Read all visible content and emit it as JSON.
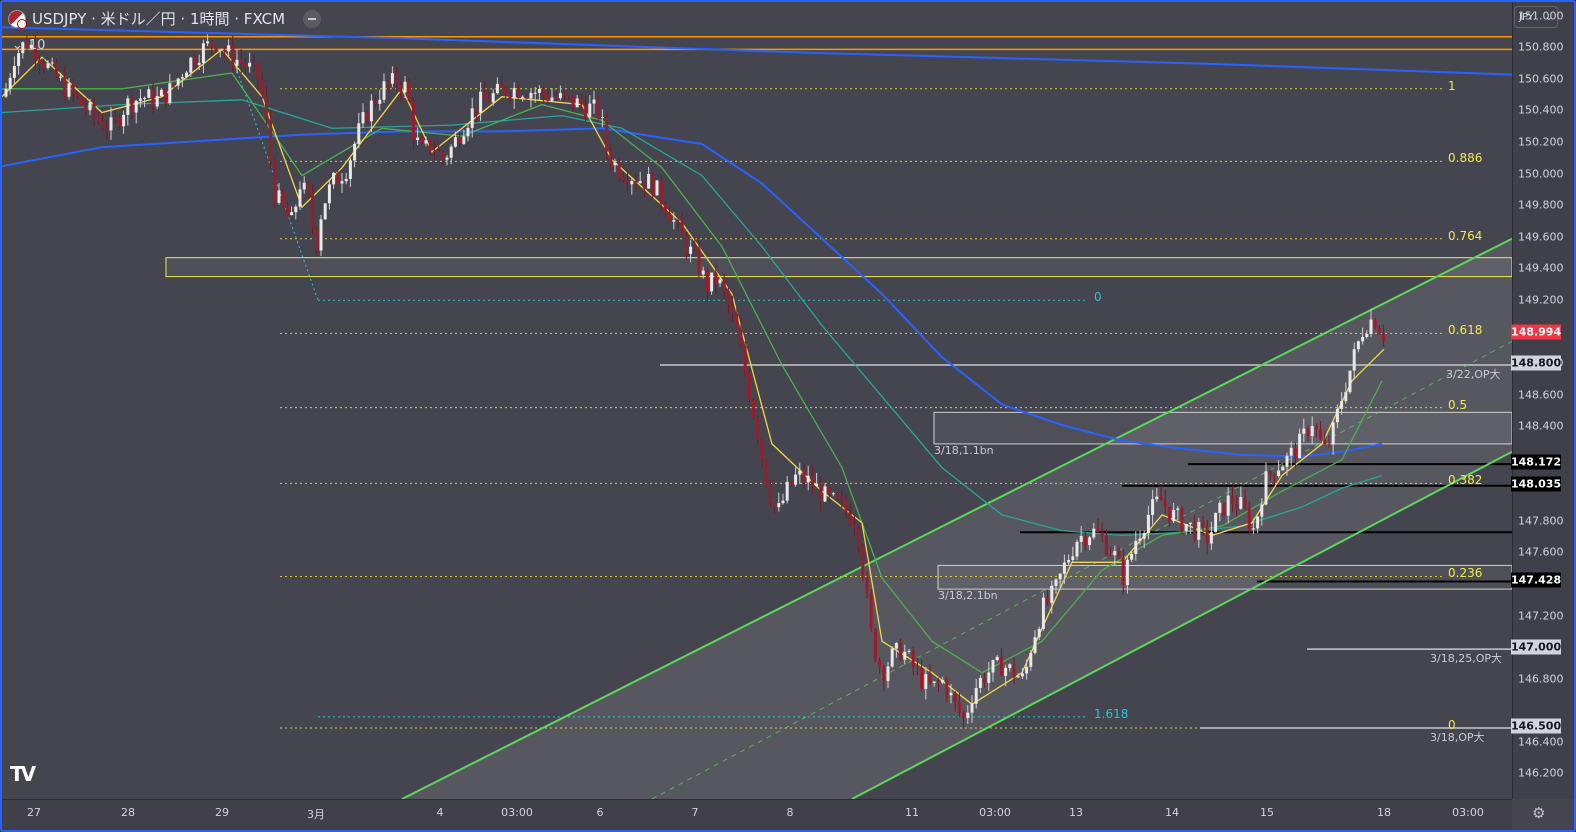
{
  "header": {
    "title": "USDJPY · 米ドル／円 · 1時間 · FXCM",
    "indicator_toggle": "10"
  },
  "currency_selector": "JPY",
  "colors": {
    "bull": "#e8e8e8",
    "bear": "#9b1c2b",
    "ema_fast": "#f5d547",
    "ema_mid": "#4caf50",
    "ema_slow": "#26a69a",
    "ma_long": "#2962ff",
    "channel": "#5bd85b",
    "fib": "#f2e94e",
    "current_price": "#f23645"
  },
  "chart_data": {
    "type": "candlestick",
    "title": "USDJPY · 米ドル／円 · 1時間 · FXCM",
    "ylim": [
      146.05,
      151.1
    ],
    "y_ticks": [
      "151.000",
      "150.800",
      "150.600",
      "150.400",
      "150.200",
      "150.000",
      "149.800",
      "149.600",
      "149.400",
      "149.200",
      "148.800",
      "148.600",
      "148.400",
      "147.800",
      "147.600",
      "147.200",
      "146.800",
      "146.400",
      "146.200"
    ],
    "x_ticks": [
      "27",
      "28",
      "29",
      "3月",
      "4",
      "03:00",
      "6",
      "7",
      "8",
      "11",
      "03:00",
      "13",
      "14",
      "15",
      "18",
      "03:00"
    ],
    "close_path": [
      [
        0,
        150.45
      ],
      [
        12,
        150.75
      ],
      [
        24,
        150.85
      ],
      [
        36,
        150.78
      ],
      [
        50,
        150.65
      ],
      [
        64,
        150.55
      ],
      [
        80,
        150.45
      ],
      [
        96,
        150.35
      ],
      [
        110,
        150.3
      ],
      [
        124,
        150.45
      ],
      [
        140,
        150.5
      ],
      [
        156,
        150.48
      ],
      [
        170,
        150.55
      ],
      [
        184,
        150.7
      ],
      [
        200,
        150.8
      ],
      [
        214,
        150.85
      ],
      [
        228,
        150.76
      ],
      [
        244,
        150.7
      ],
      [
        258,
        150.6
      ],
      [
        266,
        150.25
      ],
      [
        272,
        149.9
      ],
      [
        280,
        149.8
      ],
      [
        290,
        149.7
      ],
      [
        298,
        149.95
      ],
      [
        306,
        149.85
      ],
      [
        314,
        149.55
      ],
      [
        320,
        149.8
      ],
      [
        330,
        149.95
      ],
      [
        345,
        150.05
      ],
      [
        355,
        150.25
      ],
      [
        365,
        150.4
      ],
      [
        380,
        150.55
      ],
      [
        395,
        150.6
      ],
      [
        405,
        150.55
      ],
      [
        412,
        150.25
      ],
      [
        420,
        150.15
      ],
      [
        430,
        150.2
      ],
      [
        440,
        150.1
      ],
      [
        450,
        150.18
      ],
      [
        460,
        150.3
      ],
      [
        475,
        150.45
      ],
      [
        490,
        150.5
      ],
      [
        505,
        150.55
      ],
      [
        520,
        150.55
      ],
      [
        540,
        150.52
      ],
      [
        560,
        150.48
      ],
      [
        580,
        150.45
      ],
      [
        598,
        150.4
      ],
      [
        605,
        150.15
      ],
      [
        615,
        150.05
      ],
      [
        630,
        150.0
      ],
      [
        650,
        149.95
      ],
      [
        665,
        149.8
      ],
      [
        680,
        149.6
      ],
      [
        695,
        149.45
      ],
      [
        705,
        149.3
      ],
      [
        715,
        149.35
      ],
      [
        725,
        149.2
      ],
      [
        735,
        149.0
      ],
      [
        745,
        148.7
      ],
      [
        755,
        148.4
      ],
      [
        765,
        148.05
      ],
      [
        775,
        147.85
      ],
      [
        785,
        148.0
      ],
      [
        795,
        148.1
      ],
      [
        810,
        148.05
      ],
      [
        825,
        147.95
      ],
      [
        840,
        147.9
      ],
      [
        855,
        147.8
      ],
      [
        862,
        147.45
      ],
      [
        870,
        147.05
      ],
      [
        880,
        146.85
      ],
      [
        890,
        146.95
      ],
      [
        900,
        147.0
      ],
      [
        910,
        146.9
      ],
      [
        920,
        146.8
      ],
      [
        930,
        146.75
      ],
      [
        942,
        146.8
      ],
      [
        952,
        146.65
      ],
      [
        962,
        146.55
      ],
      [
        972,
        146.75
      ],
      [
        985,
        146.85
      ],
      [
        1000,
        146.9
      ],
      [
        1012,
        146.85
      ],
      [
        1022,
        146.8
      ],
      [
        1030,
        147.05
      ],
      [
        1040,
        147.25
      ],
      [
        1052,
        147.35
      ],
      [
        1064,
        147.55
      ],
      [
        1075,
        147.7
      ],
      [
        1090,
        147.75
      ],
      [
        1100,
        147.7
      ],
      [
        1112,
        147.6
      ],
      [
        1122,
        147.45
      ],
      [
        1134,
        147.7
      ],
      [
        1146,
        147.85
      ],
      [
        1158,
        147.95
      ],
      [
        1170,
        147.85
      ],
      [
        1182,
        147.8
      ],
      [
        1194,
        147.75
      ],
      [
        1206,
        147.7
      ],
      [
        1216,
        147.85
      ],
      [
        1228,
        147.95
      ],
      [
        1240,
        147.9
      ],
      [
        1252,
        147.75
      ],
      [
        1262,
        148.05
      ],
      [
        1272,
        148.15
      ],
      [
        1285,
        148.2
      ],
      [
        1298,
        148.3
      ],
      [
        1310,
        148.45
      ],
      [
        1322,
        148.25
      ],
      [
        1330,
        148.35
      ],
      [
        1340,
        148.6
      ],
      [
        1352,
        148.85
      ],
      [
        1362,
        149.05
      ],
      [
        1372,
        149.1
      ],
      [
        1382,
        148.99
      ]
    ],
    "series": [
      {
        "name": "",
        "color": "#2962ff",
        "points": [
          [
            0,
            150.06
          ],
          [
            100,
            150.18
          ],
          [
            200,
            150.22
          ],
          [
            300,
            150.26
          ],
          [
            400,
            150.28
          ],
          [
            500,
            150.28
          ],
          [
            600,
            150.3
          ],
          [
            700,
            150.2
          ],
          [
            760,
            149.95
          ],
          [
            820,
            149.6
          ],
          [
            880,
            149.25
          ],
          [
            940,
            148.85
          ],
          [
            1000,
            148.55
          ],
          [
            1060,
            148.42
          ],
          [
            1120,
            148.32
          ],
          [
            1180,
            148.27
          ],
          [
            1240,
            148.23
          ],
          [
            1300,
            148.22
          ],
          [
            1340,
            148.25
          ],
          [
            1380,
            148.3
          ]
        ]
      },
      {
        "name": "",
        "color": "#2962ff",
        "points": [
          [
            0,
            150.94
          ],
          [
            400,
            150.87
          ],
          [
            800,
            150.78
          ],
          [
            1200,
            150.71
          ],
          [
            1510,
            150.64
          ]
        ]
      },
      {
        "name": "",
        "color": "#26a69a",
        "points": [
          [
            0,
            150.4
          ],
          [
            120,
            150.45
          ],
          [
            240,
            150.48
          ],
          [
            330,
            150.3
          ],
          [
            450,
            150.32
          ],
          [
            560,
            150.38
          ],
          [
            620,
            150.3
          ],
          [
            700,
            150.0
          ],
          [
            760,
            149.55
          ],
          [
            820,
            149.05
          ],
          [
            880,
            148.6
          ],
          [
            940,
            148.15
          ],
          [
            1000,
            147.85
          ],
          [
            1060,
            147.75
          ],
          [
            1120,
            147.72
          ],
          [
            1180,
            147.74
          ],
          [
            1240,
            147.78
          ],
          [
            1300,
            147.9
          ],
          [
            1340,
            148.02
          ],
          [
            1380,
            148.1
          ]
        ]
      },
      {
        "name": "",
        "color": "#4caf50",
        "points": [
          [
            0,
            150.55
          ],
          [
            120,
            150.55
          ],
          [
            230,
            150.65
          ],
          [
            300,
            150.0
          ],
          [
            380,
            150.3
          ],
          [
            460,
            150.25
          ],
          [
            540,
            150.45
          ],
          [
            600,
            150.35
          ],
          [
            660,
            150.05
          ],
          [
            720,
            149.55
          ],
          [
            780,
            148.8
          ],
          [
            840,
            148.15
          ],
          [
            880,
            147.45
          ],
          [
            930,
            147.05
          ],
          [
            980,
            146.85
          ],
          [
            1040,
            147.05
          ],
          [
            1100,
            147.5
          ],
          [
            1160,
            147.72
          ],
          [
            1220,
            147.78
          ],
          [
            1280,
            148.0
          ],
          [
            1340,
            148.2
          ],
          [
            1380,
            148.7
          ]
        ]
      },
      {
        "name": "",
        "color": "#f5d547",
        "points": [
          [
            0,
            150.5
          ],
          [
            40,
            150.75
          ],
          [
            100,
            150.4
          ],
          [
            160,
            150.5
          ],
          [
            220,
            150.8
          ],
          [
            260,
            150.5
          ],
          [
            300,
            149.8
          ],
          [
            340,
            150.05
          ],
          [
            400,
            150.55
          ],
          [
            430,
            150.15
          ],
          [
            500,
            150.5
          ],
          [
            580,
            150.45
          ],
          [
            610,
            150.1
          ],
          [
            680,
            149.7
          ],
          [
            730,
            149.25
          ],
          [
            770,
            148.3
          ],
          [
            820,
            148.0
          ],
          [
            860,
            147.8
          ],
          [
            880,
            147.05
          ],
          [
            930,
            146.85
          ],
          [
            970,
            146.65
          ],
          [
            1020,
            146.85
          ],
          [
            1070,
            147.55
          ],
          [
            1120,
            147.55
          ],
          [
            1160,
            147.85
          ],
          [
            1210,
            147.72
          ],
          [
            1250,
            147.8
          ],
          [
            1280,
            148.1
          ],
          [
            1320,
            148.3
          ],
          [
            1350,
            148.7
          ],
          [
            1382,
            148.9
          ]
        ]
      }
    ],
    "channel": {
      "upper": [
        [
          400,
          146.05
        ],
        [
          1510,
          149.6
        ]
      ],
      "lower": [
        [
          850,
          146.05
        ],
        [
          1510,
          148.25
        ]
      ],
      "mid_dashed": [
        [
          650,
          146.05
        ],
        [
          1510,
          148.95
        ]
      ]
    },
    "fib_levels": [
      {
        "label": "1",
        "value": 150.55
      },
      {
        "label": "0.886",
        "value": 150.09
      },
      {
        "label": "0.764",
        "value": 149.6
      },
      {
        "label": "0.618",
        "value": 149.0
      },
      {
        "label": "0.5",
        "value": 148.53
      },
      {
        "label": "0.382",
        "value": 148.05
      },
      {
        "label": "0.236",
        "value": 147.46
      },
      {
        "label": "0",
        "value": 146.5
      }
    ],
    "fib_ext": [
      {
        "label": "0",
        "value": 149.21
      },
      {
        "label": "1.618",
        "value": 146.57
      }
    ],
    "horizontal_lines": [
      {
        "value": 150.88,
        "color": "#ff9800"
      },
      {
        "value": 150.8,
        "color": "#ff9800"
      },
      {
        "value": 148.8,
        "color": "#c8c8c8",
        "label": "3/22,OP大"
      },
      {
        "value": 148.172,
        "color": "#000000"
      },
      {
        "value": 148.035,
        "color": "#000000"
      },
      {
        "value": 147.74,
        "color": "#000000"
      },
      {
        "value": 147.428,
        "color": "#000000"
      },
      {
        "value": 147.0,
        "color": "#c8c8c8",
        "label": "3/18,25,OP大"
      },
      {
        "value": 146.5,
        "color": "#c8c8c8",
        "label": "3/18,OP大"
      }
    ],
    "zones": [
      {
        "label": "",
        "top": 149.48,
        "bottom": 149.36,
        "color": "#f2e94e"
      },
      {
        "label": "3/18,1.1bn",
        "top": 148.5,
        "bottom": 148.3,
        "color": "#d0d0d0"
      },
      {
        "label": "3/18,2.1bn",
        "top": 147.53,
        "bottom": 147.38,
        "color": "#d0d0d0"
      }
    ],
    "price_boxes": [
      {
        "value": "148.994",
        "price": 148.994,
        "bg": "#f23645",
        "fg": "#ffffff"
      },
      {
        "value": "148.800",
        "price": 148.8,
        "bg": "#d1d4dc",
        "fg": "#131722"
      },
      {
        "value": "148.172",
        "price": 148.172,
        "bg": "#000000",
        "fg": "#ffffff"
      },
      {
        "value": "148.035",
        "price": 148.035,
        "bg": "#000000",
        "fg": "#ffffff"
      },
      {
        "value": "147.428",
        "price": 147.428,
        "bg": "#000000",
        "fg": "#ffffff"
      },
      {
        "value": "147.000",
        "price": 147.0,
        "bg": "#d1d4dc",
        "fg": "#131722"
      },
      {
        "value": "146.500",
        "price": 146.5,
        "bg": "#d1d4dc",
        "fg": "#131722"
      }
    ]
  }
}
